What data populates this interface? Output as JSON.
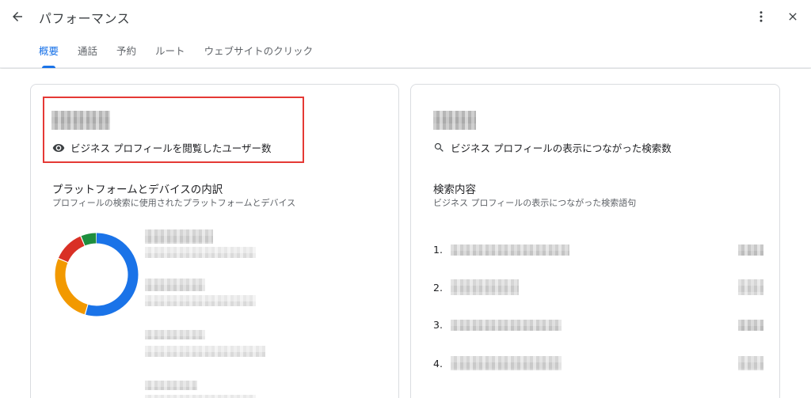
{
  "header": {
    "title": "パフォーマンス",
    "back_icon": "arrow-back-icon",
    "more_icon": "more-vert-icon",
    "close_icon": "close-icon"
  },
  "tabs": [
    {
      "label": "概要",
      "active": true
    },
    {
      "label": "通話",
      "active": false
    },
    {
      "label": "予約",
      "active": false
    },
    {
      "label": "ルート",
      "active": false
    },
    {
      "label": "ウェブサイトのクリック",
      "active": false
    }
  ],
  "left_card": {
    "metric_label": "ビジネス プロフィールを閲覧したユーザー数",
    "metric_icon": "eye-icon",
    "breakdown_title": "プラットフォームとデバイスの内訳",
    "breakdown_subtitle": "プロフィールの検索に使用されたプラットフォームとデバイス",
    "donut_segments": [
      {
        "color": "#1a73e8",
        "share": 0.53
      },
      {
        "color": "#f29900",
        "share": 0.26
      },
      {
        "color": "#d93025",
        "share": 0.12
      },
      {
        "color": "#1e8e3e",
        "share": 0.06
      }
    ]
  },
  "right_card": {
    "metric_label": "ビジネス プロフィールの表示につながった検索数",
    "metric_icon": "search-icon",
    "queries_title": "検索内容",
    "queries_subtitle": "ビジネス プロフィールの表示につながった検索語句",
    "ranks": [
      "1.",
      "2.",
      "3.",
      "4."
    ]
  },
  "colors": {
    "accent": "#1a73e8",
    "highlight_border": "#e53935"
  }
}
